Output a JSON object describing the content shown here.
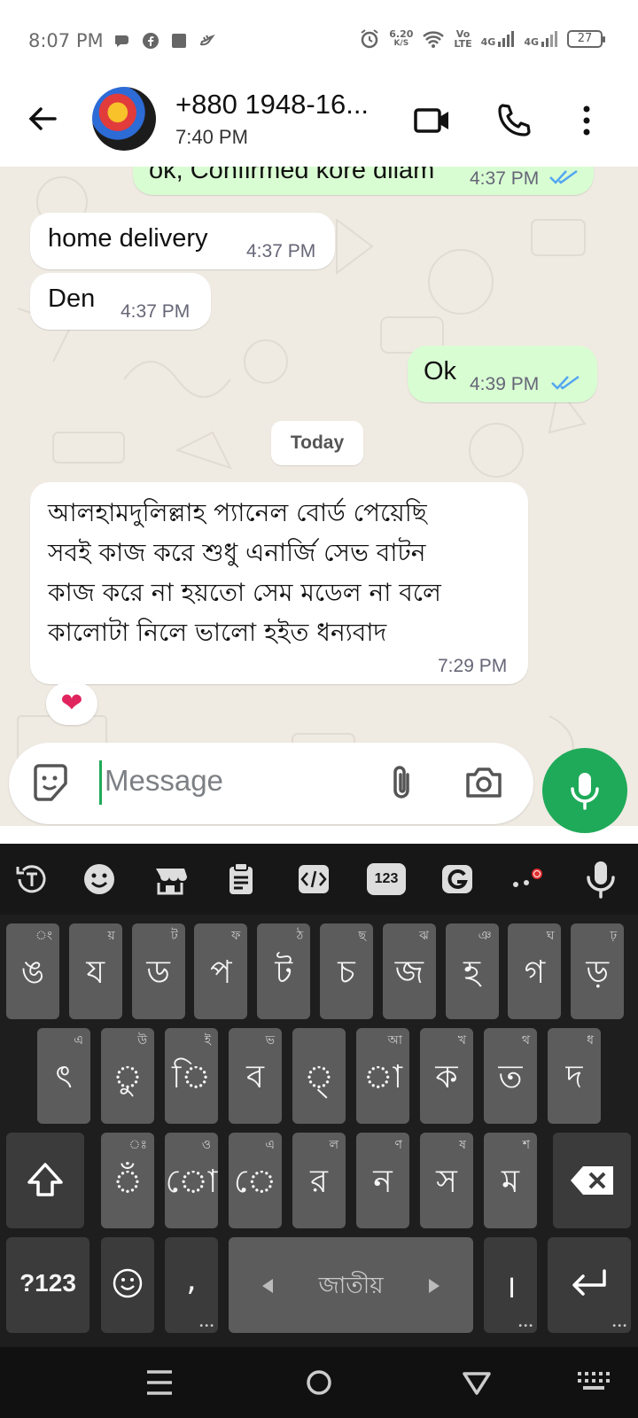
{
  "status_bar": {
    "time": "8:07 PM",
    "net_speed_value": "6.20",
    "net_speed_unit": "K/S",
    "volte_top": "Vo",
    "volte_bottom": "LTE",
    "sim1_label": "4G",
    "sim2_label": "4G",
    "battery": "27"
  },
  "header": {
    "contact_name": "+880 1948-16...",
    "subtitle": "7:40 PM"
  },
  "messages": [
    {
      "text": "ok, Confirmed kore dilam",
      "time": "4:37 PM",
      "direction": "out",
      "status": "read"
    },
    {
      "text": "home delivery",
      "time": "4:37 PM",
      "direction": "in"
    },
    {
      "text": "Den",
      "time": "4:37 PM",
      "direction": "in"
    },
    {
      "text": "Ok",
      "time": "4:39 PM",
      "direction": "out",
      "status": "read"
    },
    {
      "lines": [
        "আলহামদুলিল্লাহ প্যানেল  বোর্ড পেয়েছি",
        "সবই কাজ করে শুধু এনার্জি  সেভ বাটন",
        "কাজ করে না হয়তো সেম মডেল না বলে",
        "কালোটা নিলে ভালো হইত ধন্যবাদ"
      ],
      "time": "7:29 PM",
      "direction": "in",
      "reaction": "❤"
    }
  ],
  "date_chip": "Today",
  "composer": {
    "placeholder": "Message"
  },
  "keyboard": {
    "toolbar_numbers": "123",
    "row1": [
      {
        "main": "ঙ",
        "hint": "ং"
      },
      {
        "main": "য",
        "hint": "য়"
      },
      {
        "main": "ড",
        "hint": "ট"
      },
      {
        "main": "প",
        "hint": "ফ"
      },
      {
        "main": "ট",
        "hint": "ঠ"
      },
      {
        "main": "চ",
        "hint": "ছ"
      },
      {
        "main": "জ",
        "hint": "ঝ"
      },
      {
        "main": "হ",
        "hint": "ঞ"
      },
      {
        "main": "গ",
        "hint": "ঘ"
      },
      {
        "main": "ড়",
        "hint": "ঢ়"
      }
    ],
    "row2": [
      {
        "main": "ৎ",
        "hint": "এ"
      },
      {
        "main": "ু",
        "hint": "উ"
      },
      {
        "main": "ি",
        "hint": "ই"
      },
      {
        "main": "ব",
        "hint": "ভ"
      },
      {
        "main": "্",
        "hint": ""
      },
      {
        "main": "া",
        "hint": "আ"
      },
      {
        "main": "ক",
        "hint": "খ"
      },
      {
        "main": "ত",
        "hint": "থ"
      },
      {
        "main": "দ",
        "hint": "ধ"
      }
    ],
    "row3": [
      {
        "main": "ঁ",
        "hint": "ঃ"
      },
      {
        "main": "ো",
        "hint": "ও"
      },
      {
        "main": "ে",
        "hint": "এ"
      },
      {
        "main": "র",
        "hint": "ল"
      },
      {
        "main": "ন",
        "hint": "ণ"
      },
      {
        "main": "স",
        "hint": "ষ"
      },
      {
        "main": "ম",
        "hint": "শ"
      }
    ],
    "symbols_label": "?123",
    "comma": ",",
    "space_label": "জাতীয়",
    "danda": "।",
    "ellipsis": "•••"
  },
  "colors": {
    "accent_green": "#1faa59",
    "chat_bg": "#efeae2",
    "outgoing_bubble": "#d9fdd3",
    "read_tick": "#53a6f0"
  }
}
